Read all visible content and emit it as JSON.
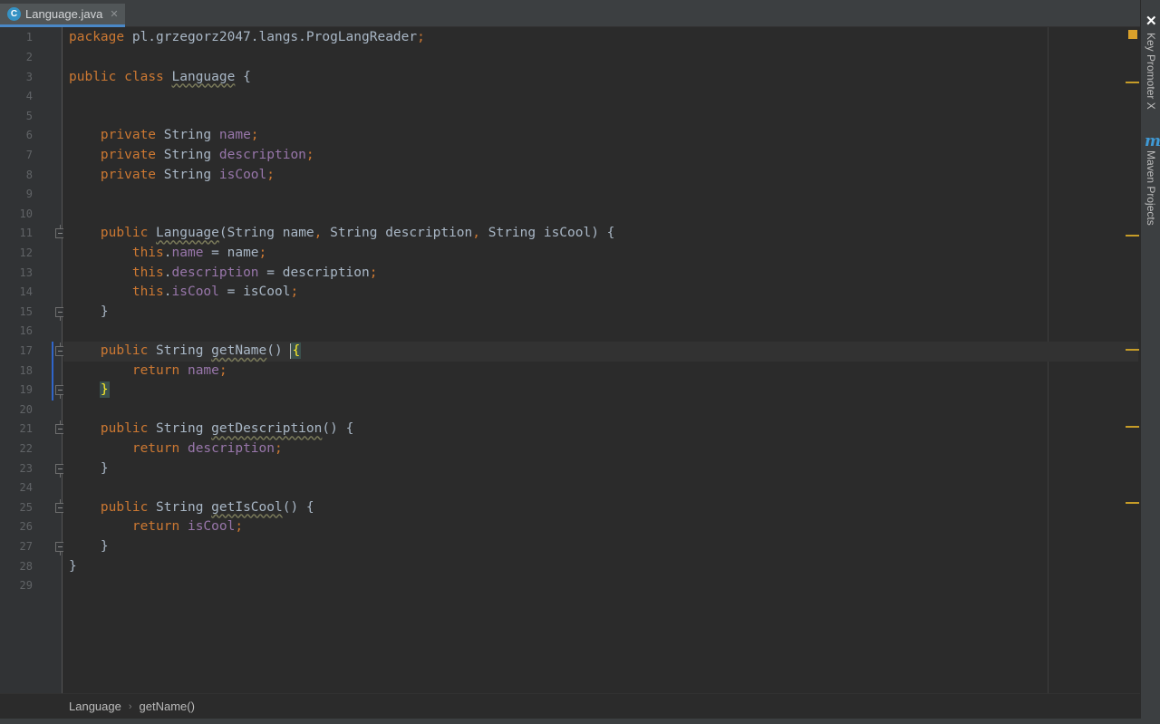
{
  "tab": {
    "icon": "C",
    "label": "Language.java",
    "close": "✕"
  },
  "code": [
    "package pl.grzegorz2047.langs.ProgLangReader;",
    "",
    "public class Language {",
    "",
    "",
    "    private String name;",
    "    private String description;",
    "    private String isCool;",
    "",
    "",
    "    public Language(String name, String description, String isCool) {",
    "        this.name = name;",
    "        this.description = description;",
    "        this.isCool = isCool;",
    "    }",
    "",
    "    public String getName() {",
    "        return name;",
    "    }",
    "",
    "    public String getDescription() {",
    "        return description;",
    "    }",
    "",
    "    public String getIsCool() {",
    "        return isCool;",
    "    }",
    "}",
    ""
  ],
  "line_numbers": [
    "1",
    "2",
    "3",
    "4",
    "5",
    "6",
    "7",
    "8",
    "9",
    "10",
    "11",
    "12",
    "13",
    "14",
    "15",
    "16",
    "17",
    "18",
    "19",
    "20",
    "21",
    "22",
    "23",
    "24",
    "25",
    "26",
    "27",
    "28",
    "29"
  ],
  "tool_window": {
    "close": "✕",
    "key_promoter": "Key Promoter X",
    "maven_icon": "m",
    "maven_projects": "Maven Projects"
  },
  "breadcrumb": {
    "items": [
      "Language",
      "getName()"
    ],
    "separator": "›"
  },
  "colors": {
    "keyword": "#cc7832",
    "field": "#9876aa",
    "text": "#a9b7c6",
    "background": "#2b2b2b",
    "warning_marker": "#c69c28"
  }
}
